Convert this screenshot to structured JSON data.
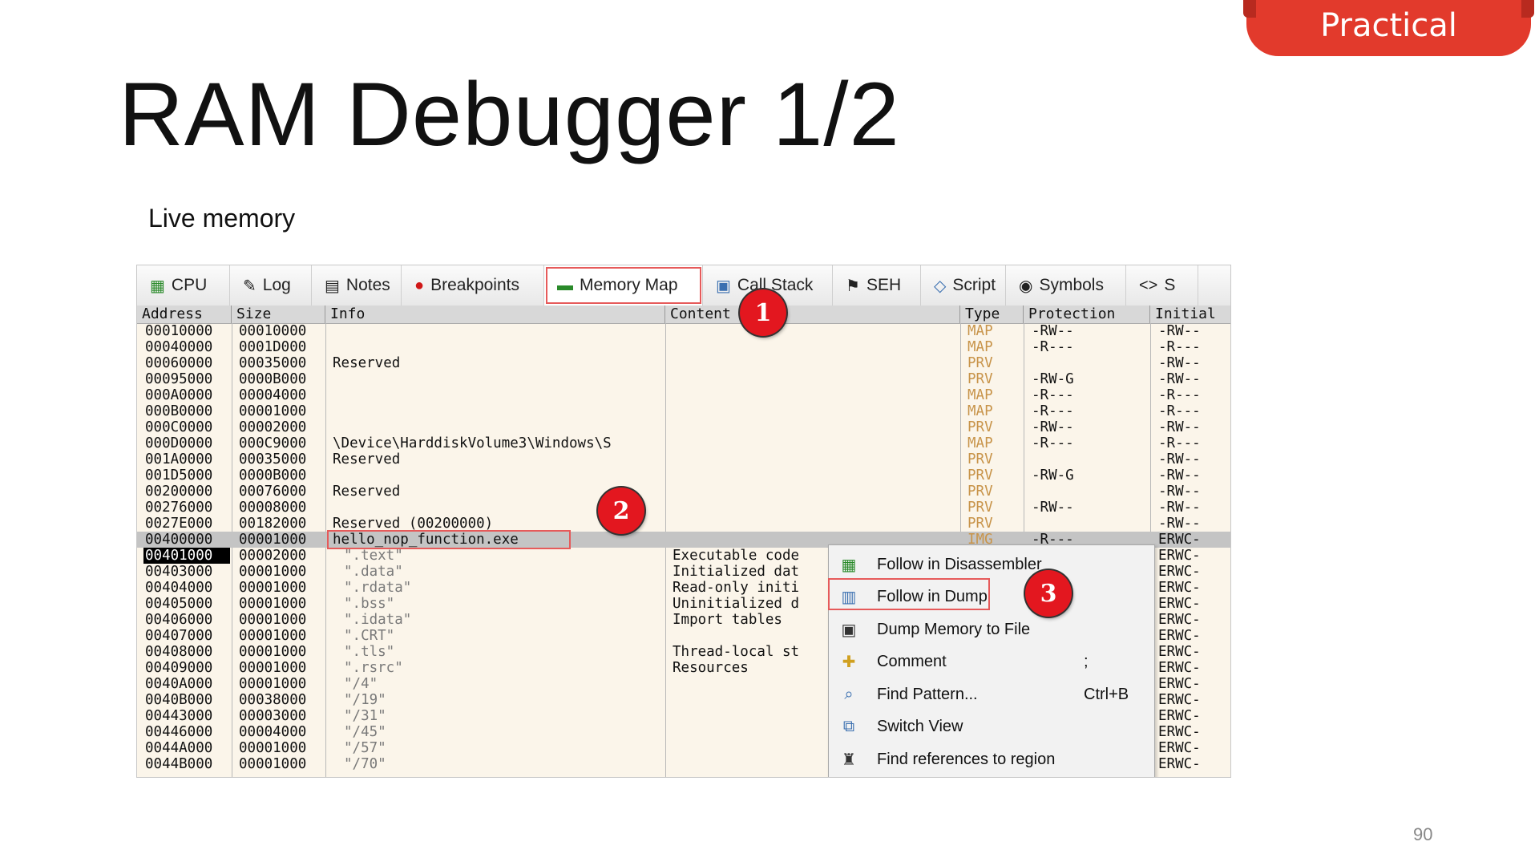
{
  "slide": {
    "badge": "Practical",
    "title": "RAM Debugger 1/2",
    "subtitle": "Live memory",
    "page_number": "90"
  },
  "tabs": [
    {
      "label": "CPU",
      "icon": "cpu-icon",
      "glyph": "▦"
    },
    {
      "label": "Log",
      "icon": "log-icon",
      "glyph": "✎"
    },
    {
      "label": "Notes",
      "icon": "notes-icon",
      "glyph": "▤"
    },
    {
      "label": "Breakpoints",
      "icon": "breakpoint-icon",
      "glyph": "●"
    },
    {
      "label": "Memory Map",
      "icon": "memory-map-icon",
      "glyph": "▬"
    },
    {
      "label": "Call Stack",
      "icon": "call-stack-icon",
      "glyph": "▣"
    },
    {
      "label": "SEH",
      "icon": "seh-icon",
      "glyph": "⚑"
    },
    {
      "label": "Script",
      "icon": "script-icon",
      "glyph": "◇"
    },
    {
      "label": "Symbols",
      "icon": "symbols-icon",
      "glyph": "◉"
    },
    {
      "label": "S",
      "icon": "source-icon",
      "glyph": "<>"
    }
  ],
  "columns": {
    "address": "Address",
    "size": "Size",
    "info": "Info",
    "content": "Content",
    "type": "Type",
    "protection": "Protection",
    "initial": "Initial"
  },
  "rows": [
    {
      "address": "00010000",
      "size": "00010000",
      "info": "",
      "content": "",
      "type": "MAP",
      "protection": "-RW--",
      "initial": "-RW--"
    },
    {
      "address": "00040000",
      "size": "0001D000",
      "info": "",
      "content": "",
      "type": "MAP",
      "protection": "-R---",
      "initial": "-R---"
    },
    {
      "address": "00060000",
      "size": "00035000",
      "info": "Reserved",
      "content": "",
      "type": "PRV",
      "protection": "",
      "initial": "-RW--"
    },
    {
      "address": "00095000",
      "size": "0000B000",
      "info": "",
      "content": "",
      "type": "PRV",
      "protection": "-RW-G",
      "initial": "-RW--"
    },
    {
      "address": "000A0000",
      "size": "00004000",
      "info": "",
      "content": "",
      "type": "MAP",
      "protection": "-R---",
      "initial": "-R---"
    },
    {
      "address": "000B0000",
      "size": "00001000",
      "info": "",
      "content": "",
      "type": "MAP",
      "protection": "-R---",
      "initial": "-R---"
    },
    {
      "address": "000C0000",
      "size": "00002000",
      "info": "",
      "content": "",
      "type": "PRV",
      "protection": "-RW--",
      "initial": "-RW--"
    },
    {
      "address": "000D0000",
      "size": "000C9000",
      "info": "\\Device\\HarddiskVolume3\\Windows\\S",
      "content": "",
      "type": "MAP",
      "protection": "-R---",
      "initial": "-R---"
    },
    {
      "address": "001A0000",
      "size": "00035000",
      "info": "Reserved",
      "content": "",
      "type": "PRV",
      "protection": "",
      "initial": "-RW--"
    },
    {
      "address": "001D5000",
      "size": "0000B000",
      "info": "",
      "content": "",
      "type": "PRV",
      "protection": "-RW-G",
      "initial": "-RW--"
    },
    {
      "address": "00200000",
      "size": "00076000",
      "info": "Reserved",
      "content": "",
      "type": "PRV",
      "protection": "",
      "initial": "-RW--"
    },
    {
      "address": "00276000",
      "size": "00008000",
      "info": "",
      "content": "",
      "type": "PRV",
      "protection": "-RW--",
      "initial": "-RW--"
    },
    {
      "address": "0027E000",
      "size": "00182000",
      "info": "Reserved (00200000)",
      "content": "",
      "type": "PRV",
      "protection": "",
      "initial": "-RW--"
    },
    {
      "address": "00400000",
      "size": "00001000",
      "info": "hello_nop_function.exe",
      "content": "",
      "type": "IMG",
      "protection": "-R---",
      "initial": "ERWC-"
    },
    {
      "address": "00401000",
      "size": "00002000",
      "info": "\".text\"",
      "content": "Executable code",
      "type": "",
      "protection": "",
      "initial": "ERWC-"
    },
    {
      "address": "00403000",
      "size": "00001000",
      "info": "\".data\"",
      "content": "Initialized dat",
      "type": "",
      "protection": "",
      "initial": "ERWC-"
    },
    {
      "address": "00404000",
      "size": "00001000",
      "info": "\".rdata\"",
      "content": "Read-only initi",
      "type": "",
      "protection": "",
      "initial": "ERWC-"
    },
    {
      "address": "00405000",
      "size": "00001000",
      "info": "\".bss\"",
      "content": "Uninitialized d",
      "type": "",
      "protection": "",
      "initial": "ERWC-"
    },
    {
      "address": "00406000",
      "size": "00001000",
      "info": "\".idata\"",
      "content": "Import tables",
      "type": "",
      "protection": "",
      "initial": "ERWC-"
    },
    {
      "address": "00407000",
      "size": "00001000",
      "info": "\".CRT\"",
      "content": "",
      "type": "",
      "protection": "",
      "initial": "ERWC-"
    },
    {
      "address": "00408000",
      "size": "00001000",
      "info": "\".tls\"",
      "content": "Thread-local st",
      "type": "",
      "protection": "",
      "initial": "ERWC-"
    },
    {
      "address": "00409000",
      "size": "00001000",
      "info": "\".rsrc\"",
      "content": "Resources",
      "type": "",
      "protection": "",
      "initial": "ERWC-"
    },
    {
      "address": "0040A000",
      "size": "00001000",
      "info": "\"/4\"",
      "content": "",
      "type": "",
      "protection": "",
      "initial": "ERWC-"
    },
    {
      "address": "0040B000",
      "size": "00038000",
      "info": "\"/19\"",
      "content": "",
      "type": "",
      "protection": "",
      "initial": "ERWC-"
    },
    {
      "address": "00443000",
      "size": "00003000",
      "info": "\"/31\"",
      "content": "",
      "type": "",
      "protection": "",
      "initial": "ERWC-"
    },
    {
      "address": "00446000",
      "size": "00004000",
      "info": "\"/45\"",
      "content": "",
      "type": "",
      "protection": "",
      "initial": "ERWC-"
    },
    {
      "address": "0044A000",
      "size": "00001000",
      "info": "\"/57\"",
      "content": "",
      "type": "",
      "protection": "",
      "initial": "ERWC-"
    },
    {
      "address": "0044B000",
      "size": "00001000",
      "info": "\"/70\"",
      "content": "",
      "type": "",
      "protection": "",
      "initial": "ERWC-"
    }
  ],
  "context_menu": [
    {
      "label": "Follow in Disassembler",
      "shortcut": "",
      "icon": "disassembler-icon",
      "glyph": "▦"
    },
    {
      "label": "Follow in Dump",
      "shortcut": "",
      "icon": "dump-icon",
      "glyph": "▥"
    },
    {
      "label": "Dump Memory to File",
      "shortcut": "",
      "icon": "save-disk-icon",
      "glyph": "▣"
    },
    {
      "label": "Comment",
      "shortcut": ";",
      "icon": "comment-icon",
      "glyph": "✚"
    },
    {
      "label": "Find Pattern...",
      "shortcut": "Ctrl+B",
      "icon": "find-icon",
      "glyph": "⌕"
    },
    {
      "label": "Switch View",
      "shortcut": "",
      "icon": "switch-view-icon",
      "glyph": "⧉"
    },
    {
      "label": "Find references to region",
      "shortcut": "",
      "icon": "binoculars-icon",
      "glyph": "♜"
    }
  ],
  "callouts": [
    "1",
    "2",
    "3"
  ],
  "colors": {
    "accent": "#e23a2c",
    "callout": "#e3171f",
    "highlight_box": "#e65a5a",
    "type_text": "#c8944a"
  }
}
